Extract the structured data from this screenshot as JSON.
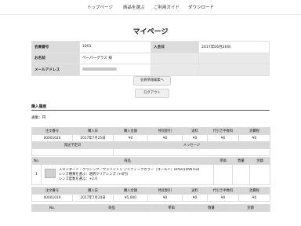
{
  "nav": {
    "items": [
      "トップページ",
      "商品を選ぶ",
      "ご利用ガイド",
      "ダウンロード"
    ]
  },
  "page_title": "マイページ",
  "account": {
    "member_no_label": "会員番号",
    "member_no": "1001",
    "join_date_label": "入会日",
    "join_date": "2017年06月26日",
    "name_label": "お名前",
    "name": "ペーパーグラス 様",
    "email_label": "メールアドレス"
  },
  "buttons": {
    "edit": "会員情報編集へ",
    "logout": "ログアウト"
  },
  "history": {
    "title": "購入履歴",
    "filter_label": "通販：円",
    "order_headers": [
      "注文番号",
      "購入日",
      "購入金額",
      "特別割引",
      "送料",
      "代引き手数料",
      "消費税"
    ],
    "ship_headers": [
      "発送予定日",
      "メッセージ"
    ],
    "item_headers": [
      "No.",
      "商品",
      "単価",
      "数量",
      "金額"
    ],
    "order1": {
      "values": [
        "00001024",
        "2017年7月25日",
        "¥0",
        "¥0",
        "¥0",
        "¥0",
        "¥0"
      ],
      "items": [
        {
          "no": "1",
          "name_lines": [
            "スタンダード・クラシック／ウェリントン アンティークカラー［ゴールド］DPG01PANTGD",
            "レンズ種類を選ぶ：透明クリアレンズ (+0円)",
            "レンズ度数を選ぶ：+2.0"
          ],
          "price": "",
          "qty": "",
          "amount": ""
        }
      ]
    },
    "order2": {
      "values": [
        "00001019",
        "2017年7月20日",
        "¥5,000",
        "¥0",
        "¥0",
        "¥0",
        "¥0"
      ],
      "item_headers": [
        "No.",
        "商品",
        "単価",
        "数量",
        "金額"
      ]
    }
  }
}
